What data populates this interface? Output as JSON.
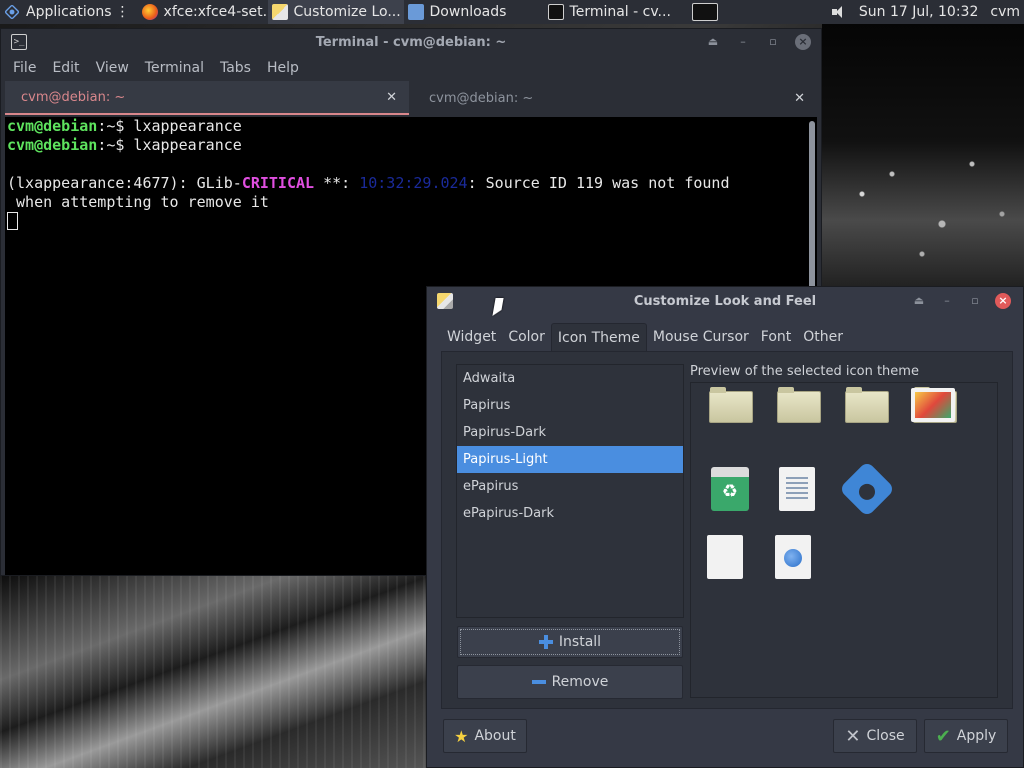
{
  "panel": {
    "applications": "Applications",
    "tasks": [
      {
        "label": "xfce:xfce4-set...",
        "icon": "firefox-icon"
      },
      {
        "label": "Customize Lo...",
        "icon": "lxappearance-icon",
        "active": true
      },
      {
        "label": "Downloads",
        "icon": "folder-icon"
      },
      {
        "label": "Terminal - cv...",
        "icon": "terminal-icon"
      }
    ],
    "clock": "Sun 17 Jul, 10:32",
    "user": "cvm"
  },
  "terminal": {
    "title": "Terminal - cvm@debian: ~",
    "menu": [
      "File",
      "Edit",
      "View",
      "Terminal",
      "Tabs",
      "Help"
    ],
    "tabs": [
      {
        "label": "cvm@debian: ~",
        "active": true
      },
      {
        "label": "cvm@debian: ~",
        "active": false
      }
    ],
    "lines": {
      "l1_user": "cvm@debian",
      "l1_rest": ":~$ lxappearance",
      "l2_user": "cvm@debian",
      "l2_rest": ":~$ lxappearance",
      "l3_pre": "(lxappearance:4677): GLib-",
      "l3_crit": "CRITICAL",
      "l3_mid": " **: ",
      "l3_ts": "10:32:29.024",
      "l3_post": ": Source ID 119 was not found",
      "l4": " when attempting to remove it"
    }
  },
  "dialog": {
    "title": "Customize Look and Feel",
    "tabs": [
      "Widget",
      "Color",
      "Icon Theme",
      "Mouse Cursor",
      "Font",
      "Other"
    ],
    "active_tab": "Icon Theme",
    "themes": [
      "Adwaita",
      "Papirus",
      "Papirus-Dark",
      "Papirus-Light",
      "ePapirus",
      "ePapirus-Dark"
    ],
    "selected_theme": "Papirus-Light",
    "install_label": "Install",
    "remove_label": "Remove",
    "preview_label": "Preview of the selected icon theme",
    "about_label": "About",
    "close_label": "Close",
    "apply_label": "Apply"
  },
  "colors": {
    "accent": "#4a8ee0",
    "prompt_user": "#5ee35e",
    "critical": "#e04fe0"
  }
}
